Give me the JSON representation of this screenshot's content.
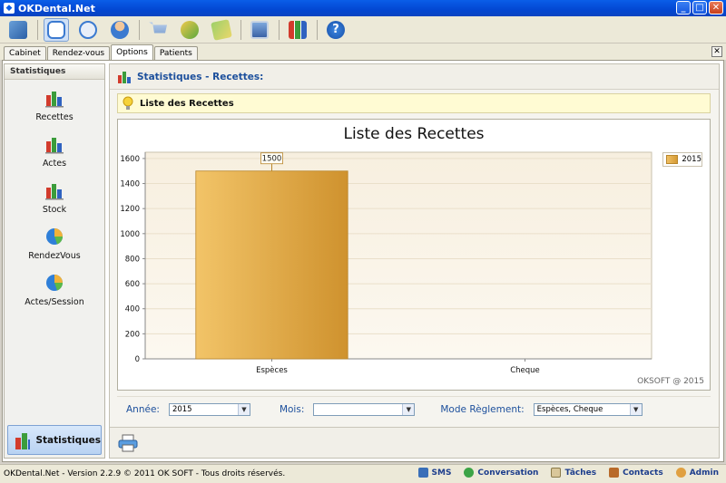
{
  "window": {
    "title": "OKDental.Net"
  },
  "toolbar": {
    "buttons": [
      {
        "icon": "dashboard-icon"
      },
      {
        "icon": "tooth-icon",
        "active": true
      },
      {
        "icon": "clock-icon"
      },
      {
        "icon": "doctor-icon"
      },
      {
        "icon": "cart-icon"
      },
      {
        "icon": "money-icon"
      },
      {
        "icon": "notes-icon"
      },
      {
        "icon": "monitor-icon"
      },
      {
        "icon": "stats-icon"
      },
      {
        "icon": "help-icon"
      }
    ]
  },
  "tabs": [
    {
      "label": "Cabinet"
    },
    {
      "label": "Rendez-vous"
    },
    {
      "label": "Options",
      "active": true
    },
    {
      "label": "Patients"
    }
  ],
  "sidebar": {
    "header": "Statistiques",
    "items": [
      {
        "label": "Recettes",
        "icon": "bar-chart-icon"
      },
      {
        "label": "Actes",
        "icon": "bar-chart-icon"
      },
      {
        "label": "Stock",
        "icon": "bar-chart-icon"
      },
      {
        "label": "RendezVous",
        "icon": "pie-chart-icon"
      },
      {
        "label": "Actes/Session",
        "icon": "pie-chart-icon"
      }
    ],
    "bottom_label": "Statistiques"
  },
  "content": {
    "header_title": "Statistiques - Recettes:",
    "info_text": "Liste des Recettes"
  },
  "chart_data": {
    "type": "bar",
    "title": "Liste des Recettes",
    "categories": [
      "Espèces",
      "Cheque"
    ],
    "series": [
      {
        "name": "2015",
        "values": [
          1500,
          0
        ],
        "color": "#e0aa45"
      }
    ],
    "value_labels": [
      "1500"
    ],
    "ylim": [
      0,
      1650
    ],
    "yticks": [
      0,
      200,
      400,
      600,
      800,
      1000,
      1200,
      1400,
      1600
    ],
    "ytick_labels": [
      "0",
      "200",
      "400",
      "600",
      "800",
      "1000",
      "1200",
      "1400",
      "1600"
    ],
    "grid": true,
    "legend": "top-right",
    "watermark": "OKSOFT @ 2015"
  },
  "filters": {
    "annee_label": "Année:",
    "annee_value": "2015",
    "mois_label": "Mois:",
    "mois_value": "",
    "mode_label": "Mode Règlement:",
    "mode_value": "Espèces, Cheque"
  },
  "status": {
    "copyright": "OKDental.Net - Version 2.2.9 © 2011 OK SOFT - Tous droits réservés.",
    "sms": "SMS",
    "conversation": "Conversation",
    "taches": "Tâches",
    "contacts": "Contacts",
    "admin": "Admin"
  },
  "colors": {
    "accent": "#1c4f9c",
    "bar": "#e0aa45",
    "titlebar": "#0347d2"
  }
}
